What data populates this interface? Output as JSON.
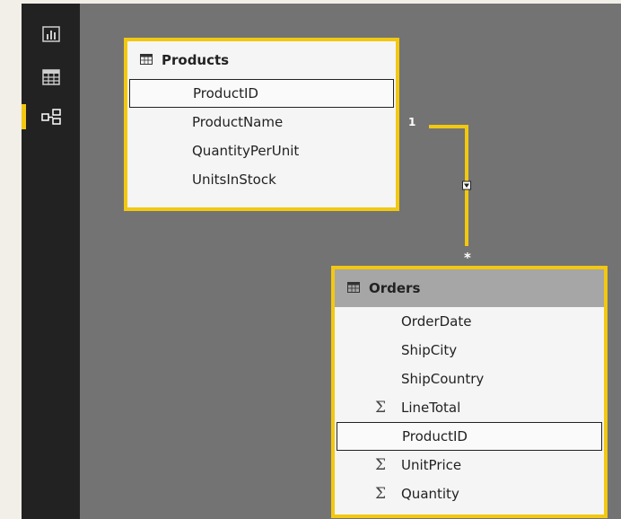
{
  "sidebar": {
    "items": [
      {
        "name": "report-view",
        "icon": "bar-chart-icon"
      },
      {
        "name": "data-view",
        "icon": "table-grid-icon"
      },
      {
        "name": "model-view",
        "icon": "relationship-icon",
        "active": true
      }
    ]
  },
  "products": {
    "title": "Products",
    "fields": [
      "ProductID",
      "ProductName",
      "QuantityPerUnit",
      "UnitsInStock"
    ],
    "selected_field": "ProductID"
  },
  "orders": {
    "title": "Orders",
    "fields": [
      {
        "label": "OrderDate",
        "sigma": false
      },
      {
        "label": "ShipCity",
        "sigma": false
      },
      {
        "label": "ShipCountry",
        "sigma": false
      },
      {
        "label": "LineTotal",
        "sigma": true
      },
      {
        "label": "ProductID",
        "sigma": false
      },
      {
        "label": "UnitPrice",
        "sigma": true
      },
      {
        "label": "Quantity",
        "sigma": true
      }
    ],
    "selected_field": "ProductID"
  },
  "relationship": {
    "one_label": "1",
    "many_label": "*",
    "sigma_symbol": "Σ"
  },
  "colors": {
    "accent": "#f2c811",
    "canvas": "#737373",
    "sidebar": "#222222"
  }
}
